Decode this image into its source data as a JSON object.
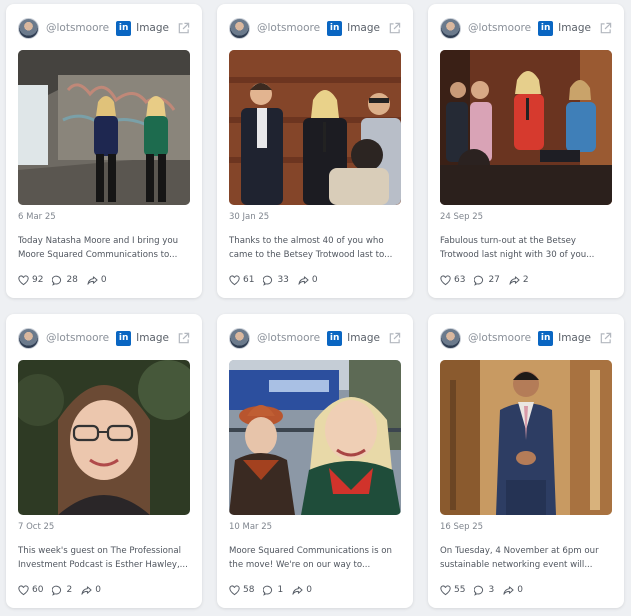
{
  "posts": [
    {
      "handle": "@lotsmoore",
      "platform_icon": "linkedin-icon",
      "type_label": "Image",
      "date": "6 Mar 25",
      "text": "Today Natasha Moore and I bring you Moore Squared Communications to...",
      "likes": "92",
      "comments": "28",
      "shares": "0"
    },
    {
      "handle": "@lotsmoore",
      "platform_icon": "linkedin-icon",
      "type_label": "Image",
      "date": "30 Jan 25",
      "text": "Thanks to the almost 40 of you who came to the Betsey Trotwood last to...",
      "likes": "61",
      "comments": "33",
      "shares": "0"
    },
    {
      "handle": "@lotsmoore",
      "platform_icon": "linkedin-icon",
      "type_label": "Image",
      "date": "24 Sep 25",
      "text": "Fabulous turn-out at the Betsey Trotwood last night with 30 of you...",
      "likes": "63",
      "comments": "27",
      "shares": "2"
    },
    {
      "handle": "@lotsmoore",
      "platform_icon": "linkedin-icon",
      "type_label": "Image",
      "date": "7 Oct 25",
      "text": "This week's guest on The Professional Investment Podcast is Esther Hawley,...",
      "likes": "60",
      "comments": "2",
      "shares": "0"
    },
    {
      "handle": "@lotsmoore",
      "platform_icon": "linkedin-icon",
      "type_label": "Image",
      "date": "10 Mar 25",
      "text": "Moore Squared Communications is on the move! We're on our way to...",
      "likes": "58",
      "comments": "1",
      "shares": "0"
    },
    {
      "handle": "@lotsmoore",
      "platform_icon": "linkedin-icon",
      "type_label": "Image",
      "date": "16 Sep 25",
      "text": "On Tuesday, 4 November at 6pm our sustainable networking event will...",
      "likes": "55",
      "comments": "3",
      "shares": "0"
    }
  ],
  "colors": {
    "linkedin": "#0a66c2",
    "background": "#eef0f3",
    "card": "#ffffff"
  }
}
